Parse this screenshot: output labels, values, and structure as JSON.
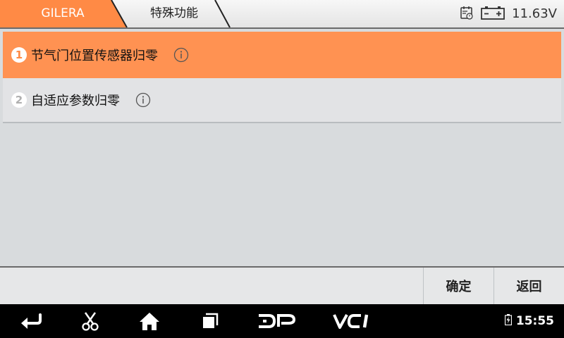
{
  "header": {
    "crumbs": [
      {
        "label": "GILERA"
      },
      {
        "label": "特殊功能"
      }
    ],
    "voltage": "11.63V",
    "accent_color": "#ff8a45"
  },
  "menu": {
    "items": [
      {
        "number": "1",
        "label": "节气门位置传感器归零",
        "selected": true
      },
      {
        "number": "2",
        "label": "自适应参数归零",
        "selected": false
      }
    ]
  },
  "buttons": {
    "ok_label": "确定",
    "back_label": "返回"
  },
  "navbar": {
    "icons": [
      "back-icon",
      "scissors-icon",
      "home-icon",
      "recent-apps-icon",
      "dp-icon",
      "vci-icon"
    ],
    "dp_label": "DP",
    "vci_label": "VCI",
    "time": "15:55"
  }
}
